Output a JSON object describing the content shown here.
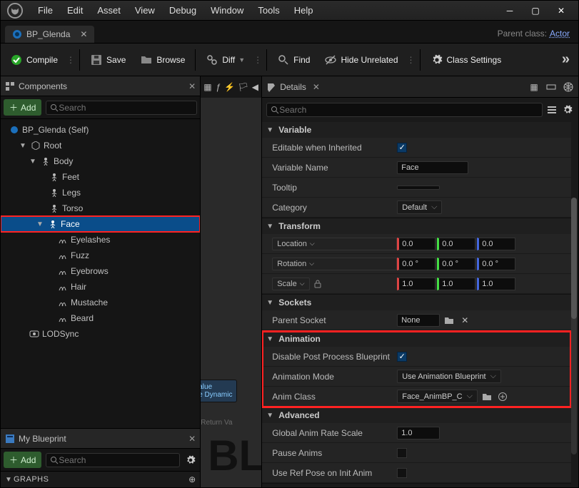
{
  "menubar": [
    "File",
    "Edit",
    "Asset",
    "View",
    "Debug",
    "Window",
    "Tools",
    "Help"
  ],
  "tab": {
    "title": "BP_Glenda"
  },
  "parent_class": {
    "label": "Parent class:",
    "value": "Actor"
  },
  "toolbar": {
    "compile": "Compile",
    "save": "Save",
    "browse": "Browse",
    "diff": "Diff",
    "find": "Find",
    "hide_unrelated": "Hide Unrelated",
    "class_settings": "Class Settings"
  },
  "components_panel": {
    "title": "Components",
    "add": "Add",
    "search_placeholder": "Search",
    "items": {
      "root_self": "BP_Glenda (Self)",
      "root": "Root",
      "body": "Body",
      "feet": "Feet",
      "legs": "Legs",
      "torso": "Torso",
      "face": "Face",
      "eyelashes": "Eyelashes",
      "fuzz": "Fuzz",
      "eyebrows": "Eyebrows",
      "hair": "Hair",
      "mustache": "Mustache",
      "beard": "Beard",
      "lodsync": "LODSync"
    }
  },
  "myblueprint": {
    "title": "My Blueprint",
    "add": "Add",
    "search_placeholder": "Search",
    "graphs": "GRAPHS"
  },
  "center": {
    "node_value": "alue",
    "node_dynamic": "e Dynamic",
    "return_va": "Return Va",
    "bg": "BL"
  },
  "details": {
    "title": "Details",
    "search_placeholder": "Search",
    "sections": {
      "variable": "Variable",
      "transform": "Transform",
      "sockets": "Sockets",
      "animation": "Animation",
      "advanced": "Advanced"
    },
    "variable": {
      "editable_inherited": "Editable when Inherited",
      "variable_name_label": "Variable Name",
      "variable_name_value": "Face",
      "tooltip_label": "Tooltip",
      "tooltip_value": "",
      "category_label": "Category",
      "category_value": "Default"
    },
    "transform": {
      "location_label": "Location",
      "rotation_label": "Rotation",
      "scale_label": "Scale",
      "loc": {
        "x": "0.0",
        "y": "0.0",
        "z": "0.0"
      },
      "rot": {
        "x": "0.0 °",
        "y": "0.0 °",
        "z": "0.0 °"
      },
      "scl": {
        "x": "1.0",
        "y": "1.0",
        "z": "1.0"
      }
    },
    "sockets": {
      "parent_socket_label": "Parent Socket",
      "parent_socket_value": "None"
    },
    "animation": {
      "disable_pp_label": "Disable Post Process Blueprint",
      "anim_mode_label": "Animation Mode",
      "anim_mode_value": "Use Animation Blueprint",
      "anim_class_label": "Anim Class",
      "anim_class_value": "Face_AnimBP_C"
    },
    "advanced": {
      "global_rate_label": "Global Anim Rate Scale",
      "global_rate_value": "1.0",
      "pause_anims_label": "Pause Anims",
      "use_ref_pose_label": "Use Ref Pose on Init Anim"
    }
  }
}
